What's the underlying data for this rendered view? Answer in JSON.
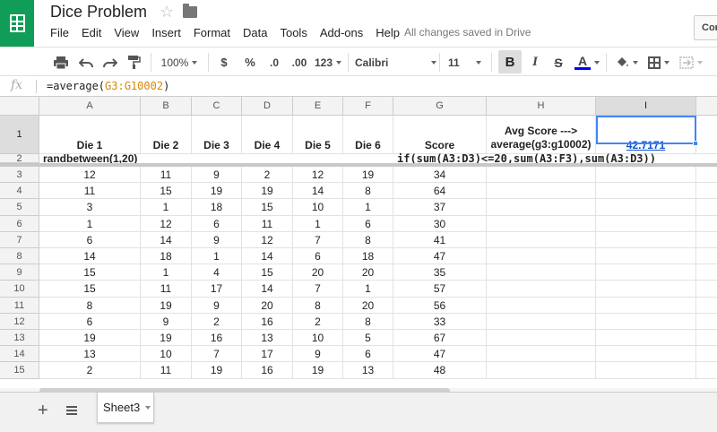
{
  "header": {
    "title": "Dice Problem",
    "menu": [
      "File",
      "Edit",
      "View",
      "Insert",
      "Format",
      "Data",
      "Tools",
      "Add-ons",
      "Help"
    ],
    "save_status": "All changes saved in Drive",
    "comments_label": "Com"
  },
  "toolbar": {
    "zoom": "100%",
    "currency": "$",
    "percent": "%",
    "decrease_decimals": ".0",
    "increase_decimals": ".00",
    "more_formats": "123",
    "font": "Calibri",
    "font_size": "11",
    "bold": "B",
    "italic": "I",
    "strikethrough": "S",
    "text_color": "A",
    "text_color_value": "#0000ff"
  },
  "formula_bar": {
    "fx": "fx",
    "prefix": "=average(",
    "range": "G3:G10002",
    "suffix": ")"
  },
  "columns": [
    "A",
    "B",
    "C",
    "D",
    "E",
    "F",
    "G",
    "H",
    "I"
  ],
  "selected_column": "I",
  "row1": {
    "A": "Die 1",
    "B": "Die 2",
    "C": "Die 3",
    "D": "Die 4",
    "E": "Die 5",
    "F": "Die 6",
    "G": "Score",
    "H_line1": "Avg Score --->",
    "H_line2": "average(g3:g10002)",
    "I": "42.7171"
  },
  "row2": {
    "A": "randbetween(1,20)",
    "F": "if(sum(A3:D3)<=20,sum(A3:F3),sum(A3:D3))"
  },
  "rows": [
    {
      "n": "3",
      "v": [
        "12",
        "11",
        "9",
        "2",
        "12",
        "19",
        "34"
      ]
    },
    {
      "n": "4",
      "v": [
        "11",
        "15",
        "19",
        "19",
        "14",
        "8",
        "64"
      ]
    },
    {
      "n": "5",
      "v": [
        "3",
        "1",
        "18",
        "15",
        "10",
        "1",
        "37"
      ]
    },
    {
      "n": "6",
      "v": [
        "1",
        "12",
        "6",
        "11",
        "1",
        "6",
        "30"
      ]
    },
    {
      "n": "7",
      "v": [
        "6",
        "14",
        "9",
        "12",
        "7",
        "8",
        "41"
      ]
    },
    {
      "n": "8",
      "v": [
        "14",
        "18",
        "1",
        "14",
        "6",
        "18",
        "47"
      ]
    },
    {
      "n": "9",
      "v": [
        "15",
        "1",
        "4",
        "15",
        "20",
        "20",
        "35"
      ]
    },
    {
      "n": "10",
      "v": [
        "15",
        "11",
        "17",
        "14",
        "7",
        "1",
        "57"
      ]
    },
    {
      "n": "11",
      "v": [
        "8",
        "19",
        "9",
        "20",
        "8",
        "20",
        "56"
      ]
    },
    {
      "n": "12",
      "v": [
        "6",
        "9",
        "2",
        "16",
        "2",
        "8",
        "33"
      ]
    },
    {
      "n": "13",
      "v": [
        "19",
        "19",
        "16",
        "13",
        "10",
        "5",
        "67"
      ]
    },
    {
      "n": "14",
      "v": [
        "13",
        "10",
        "7",
        "17",
        "9",
        "6",
        "47"
      ]
    },
    {
      "n": "15",
      "v": [
        "2",
        "11",
        "19",
        "16",
        "19",
        "13",
        "48"
      ]
    }
  ],
  "sheets": {
    "add": "+",
    "tabs": [
      "Sheet3"
    ]
  }
}
